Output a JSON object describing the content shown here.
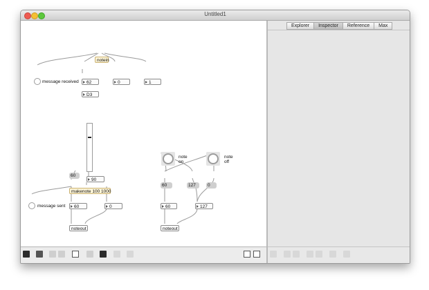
{
  "window": {
    "title": "Untitled1"
  },
  "sidebar": {
    "tabs": [
      {
        "label": "Explorer",
        "active": false
      },
      {
        "label": "Inspector",
        "active": true
      },
      {
        "label": "Reference",
        "active": false
      },
      {
        "label": "Max",
        "active": false
      }
    ]
  },
  "patcher": {
    "notein": "notein",
    "message_received": "message received",
    "pitch": "62",
    "velocity": "0",
    "channel": "1",
    "note_name": "D3",
    "slider_value": "90",
    "velocity_msg": "60",
    "makenote": "makenote 100 1000",
    "message_sent": "message sent",
    "out_pitch": "60",
    "out_velocity": "0",
    "noteout_left": "noteout",
    "note_on_label": "note\non",
    "note_off_label": "note\noff",
    "msg_60": "60",
    "msg_127": "127",
    "msg_0": "0",
    "right_pitch": "60",
    "right_velocity": "127",
    "noteout_right": "noteout"
  },
  "colors": {
    "canvas": "#ffffff",
    "window_chrome": "#ececec",
    "highlight_object": "#fff6d8",
    "message_box": "#cfcfcf",
    "close": "#ee5b52",
    "minimize": "#f5bf34",
    "zoom": "#5dc83c"
  },
  "icons": {
    "toolbar_left": [
      "lock-icon",
      "presentation-icon",
      "grid-icon",
      "new-object-icon",
      "inspector-icon",
      "info-icon",
      "bring-front-icon",
      "send-back-icon",
      "align-icon"
    ],
    "toolbar_right": [
      "patcher-view-icon",
      "sidebar-toggle-icon"
    ],
    "sidebar_toolbar": [
      "sidebar-action-icon"
    ]
  }
}
